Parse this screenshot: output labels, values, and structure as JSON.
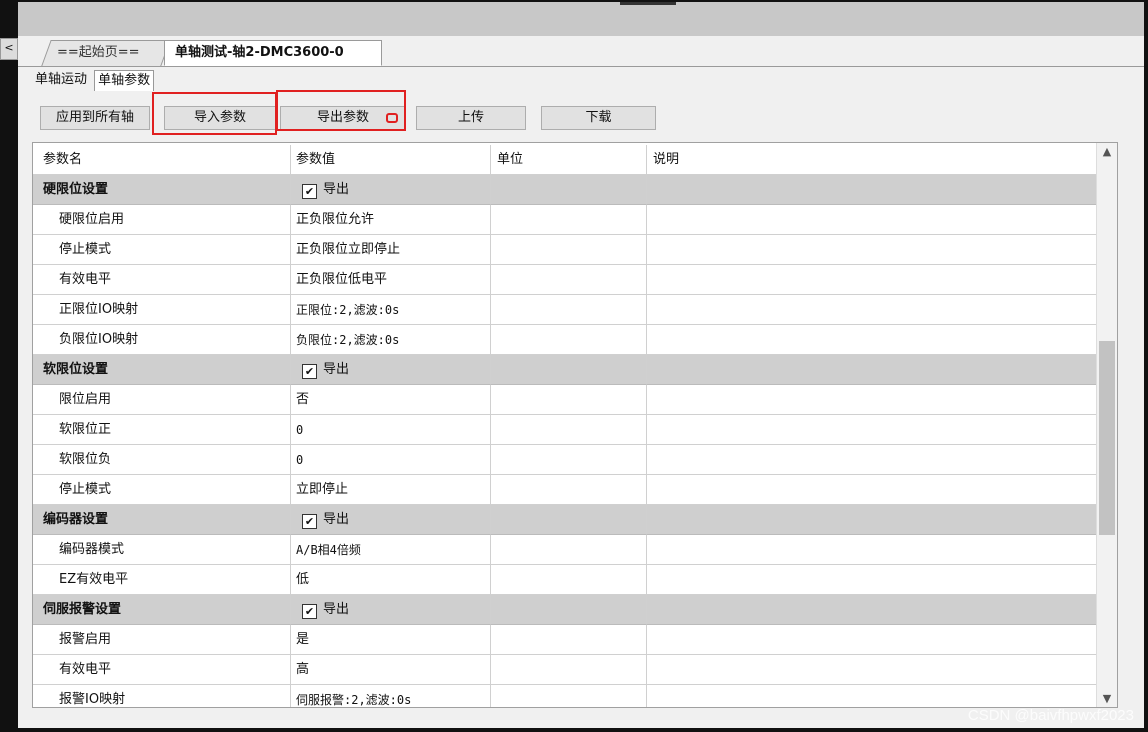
{
  "left_stub": "<",
  "doc_tabs": [
    {
      "label": "==起始页=="
    },
    {
      "label": "单轴测试-轴2-DMC3600-0"
    }
  ],
  "sub_tabs": [
    {
      "label": "单轴运动"
    },
    {
      "label": "单轴参数"
    }
  ],
  "buttons": {
    "apply_all": "应用到所有轴",
    "import": "导入参数",
    "export": "导出参数",
    "upload": "上传",
    "download": "下载"
  },
  "table": {
    "headers": [
      "参数名",
      "参数值",
      "单位",
      "说明"
    ],
    "check_label": "导出",
    "check_mark": "✔",
    "groups": [
      {
        "name": "硬限位设置",
        "rows": [
          {
            "name": "硬限位启用",
            "value": "正负限位允许"
          },
          {
            "name": "停止模式",
            "value": "正负限位立即停止"
          },
          {
            "name": "有效电平",
            "value": "正负限位低电平"
          },
          {
            "name": "正限位IO映射",
            "value": "正限位:2,滤波:0s"
          },
          {
            "name": "负限位IO映射",
            "value": "负限位:2,滤波:0s"
          }
        ]
      },
      {
        "name": "软限位设置",
        "rows": [
          {
            "name": "限位启用",
            "value": "否"
          },
          {
            "name": "软限位正",
            "value": "0"
          },
          {
            "name": "软限位负",
            "value": "0"
          },
          {
            "name": "停止模式",
            "value": "立即停止"
          }
        ]
      },
      {
        "name": "编码器设置",
        "rows": [
          {
            "name": "编码器模式",
            "value": "A/B相4倍频"
          },
          {
            "name": "EZ有效电平",
            "value": "低"
          }
        ]
      },
      {
        "name": "伺服报警设置",
        "rows": [
          {
            "name": "报警启用",
            "value": "是"
          },
          {
            "name": "有效电平",
            "value": "高"
          },
          {
            "name": "报警IO映射",
            "value": "伺服报警:2,滤波:0s"
          }
        ]
      }
    ]
  },
  "scrollbar": {
    "up": "▲",
    "down": "▼"
  },
  "highlight_color": "#e02020",
  "watermark": "CSDN @baivfhpwxf2023"
}
